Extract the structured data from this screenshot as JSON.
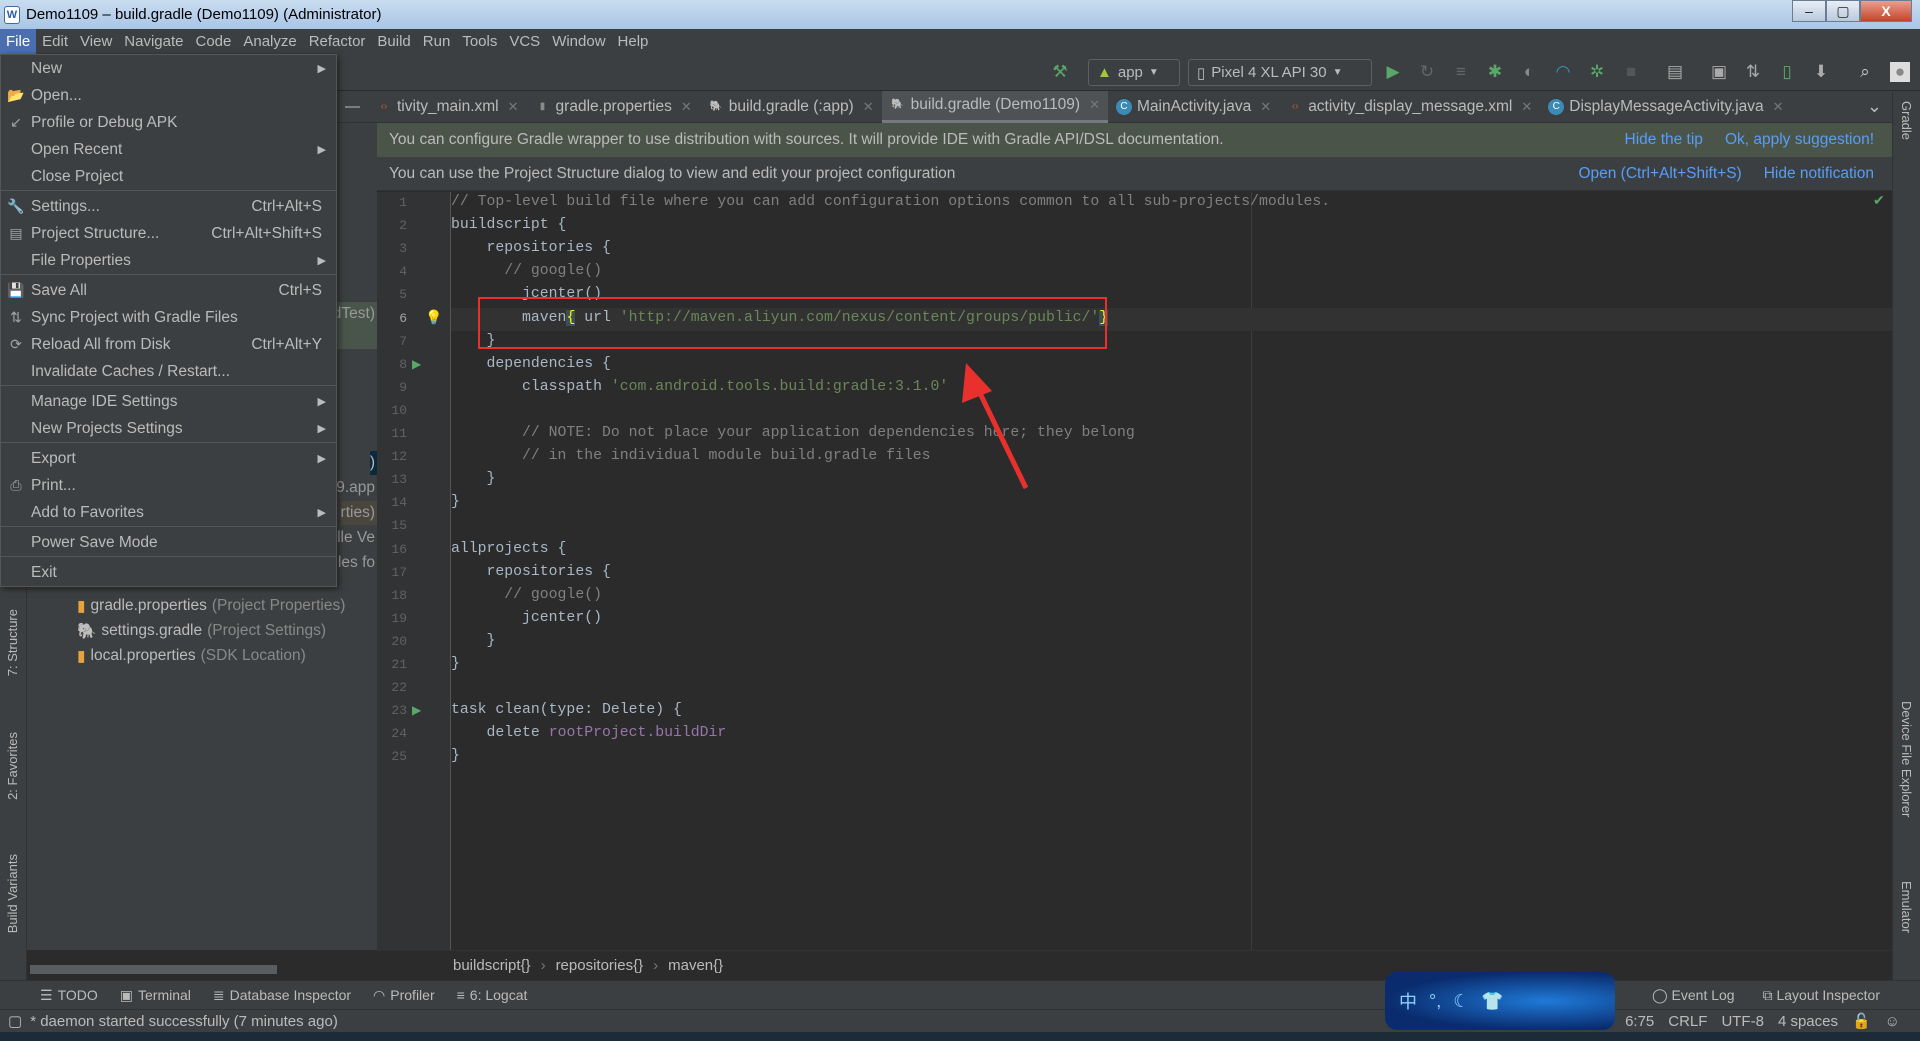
{
  "window": {
    "title": "Demo1109 – build.gradle (Demo1109) (Administrator)",
    "minimize": "–",
    "maximize": "▢",
    "close": "X"
  },
  "menubar": [
    "File",
    "Edit",
    "View",
    "Navigate",
    "Code",
    "Analyze",
    "Refactor",
    "Build",
    "Run",
    "Tools",
    "VCS",
    "Window",
    "Help"
  ],
  "toolbar": {
    "run_config": "app",
    "device": "Pixel 4 XL API 30",
    "icons": [
      "hammer-icon",
      "run-icon",
      "apply-changes-icon",
      "apply-code-changes-icon",
      "debug-icon",
      "attach-debugger-icon",
      "profile-icon",
      "debug-app-icon",
      "stop-icon",
      "project-structure-icon",
      "avd-manager-icon",
      "sync-gradle-icon",
      "device-manager-icon",
      "sdk-manager-icon",
      "search-icon",
      "account-icon"
    ]
  },
  "tabs": [
    {
      "label": "tivity_main.xml",
      "icon": "xml-icon"
    },
    {
      "label": "gradle.properties",
      "icon": "properties-icon"
    },
    {
      "label": "build.gradle (:app)",
      "icon": "gradle-icon"
    },
    {
      "label": "build.gradle (Demo1109)",
      "icon": "gradle-icon",
      "active": true
    },
    {
      "label": "MainActivity.java",
      "icon": "class-icon"
    },
    {
      "label": "activity_display_message.xml",
      "icon": "xml-icon"
    },
    {
      "label": "DisplayMessageActivity.java",
      "icon": "class-icon"
    }
  ],
  "notifications": [
    {
      "text": "You can configure Gradle wrapper to use distribution with sources. It will provide IDE with Gradle API/DSL documentation.",
      "links": [
        "Hide the tip",
        "Ok, apply suggestion!"
      ]
    },
    {
      "text": "You can use the Project Structure dialog to view and edit your project configuration",
      "links": [
        "Open (Ctrl+Alt+Shift+S)",
        "Hide notification"
      ]
    }
  ],
  "file_menu": [
    {
      "label": "New",
      "submenu": true
    },
    {
      "label": "Open...",
      "icon": "folder-icon"
    },
    {
      "label": "Profile or Debug APK",
      "icon": "profile-apk-icon"
    },
    {
      "label": "Open Recent",
      "submenu": true
    },
    {
      "label": "Close Project",
      "sep_after": true
    },
    {
      "label": "Settings...",
      "shortcut": "Ctrl+Alt+S",
      "icon": "wrench-icon"
    },
    {
      "label": "Project Structure...",
      "shortcut": "Ctrl+Alt+Shift+S",
      "icon": "project-structure-icon"
    },
    {
      "label": "File Properties",
      "submenu": true,
      "sep_after": true
    },
    {
      "label": "Save All",
      "shortcut": "Ctrl+S",
      "icon": "save-icon"
    },
    {
      "label": "Sync Project with Gradle Files",
      "icon": "gradle-sync-icon"
    },
    {
      "label": "Reload All from Disk",
      "shortcut": "Ctrl+Alt+Y",
      "icon": "reload-icon"
    },
    {
      "label": "Invalidate Caches / Restart...",
      "sep_after": true
    },
    {
      "label": "Manage IDE Settings",
      "submenu": true
    },
    {
      "label": "New Projects Settings",
      "submenu": true,
      "sep_after": true
    },
    {
      "label": "Export",
      "submenu": true
    },
    {
      "label": "Print...",
      "icon": "print-icon"
    },
    {
      "label": "Add to Favorites",
      "submenu": true,
      "sep_after": true
    },
    {
      "label": "Power Save Mode",
      "sep_after": true
    },
    {
      "label": "Exit"
    }
  ],
  "project_tree": {
    "fragments": [
      "dTest)",
      ")",
      "9.app",
      "rties)",
      "lle Ve",
      "ules fo"
    ],
    "items": [
      {
        "name": "gradle.properties",
        "hint": "(Project Properties)"
      },
      {
        "name": "settings.gradle",
        "hint": "(Project Settings)"
      },
      {
        "name": "local.properties",
        "hint": "(SDK Location)"
      }
    ]
  },
  "left_tools": [
    "7: Structure",
    "2: Favorites",
    "Build Variants"
  ],
  "right_tools": [
    "Gradle",
    "Device File Explorer",
    "Emulator"
  ],
  "editor": {
    "current_line": 6,
    "lines": [
      [
        [
          "c-com",
          "// Top-level build file where you can add configuration options common to all sub-projects/modules."
        ]
      ],
      [
        [
          "",
          "buildscript {"
        ]
      ],
      [
        [
          "",
          "    repositories {"
        ]
      ],
      [
        [
          "c-com",
          "      // google()"
        ]
      ],
      [
        [
          "",
          "        jcenter()"
        ]
      ],
      [
        [
          "",
          "        maven"
        ],
        [
          "c-brace",
          "{"
        ],
        [
          "",
          " url "
        ],
        [
          "c-str",
          "'http://maven.aliyun.com/nexus/content/groups/public/'"
        ],
        [
          "c-brace",
          "}"
        ]
      ],
      [
        [
          "",
          "    }"
        ]
      ],
      [
        [
          "",
          "    dependencies {"
        ]
      ],
      [
        [
          "",
          "        classpath "
        ],
        [
          "c-str",
          "'com.android.tools.build:gradle:3.1.0'"
        ]
      ],
      [
        [
          "",
          ""
        ]
      ],
      [
        [
          "c-com",
          "        // NOTE: Do not place your application dependencies here; they belong"
        ]
      ],
      [
        [
          "c-com",
          "        // in the individual module build.gradle files"
        ]
      ],
      [
        [
          "",
          "    }"
        ]
      ],
      [
        [
          "",
          "}"
        ]
      ],
      [
        [
          "",
          ""
        ]
      ],
      [
        [
          "",
          "allprojects {"
        ]
      ],
      [
        [
          "",
          "    repositories {"
        ]
      ],
      [
        [
          "c-com",
          "      // google()"
        ]
      ],
      [
        [
          "",
          "        jcenter()"
        ]
      ],
      [
        [
          "",
          "    }"
        ]
      ],
      [
        [
          "",
          "}"
        ]
      ],
      [
        [
          "",
          ""
        ]
      ],
      [
        [
          "",
          "task clean(type: Delete) {"
        ]
      ],
      [
        [
          "",
          "    delete "
        ],
        [
          "c-prop",
          "rootProject.buildDir"
        ]
      ],
      [
        [
          "",
          "}"
        ]
      ]
    ],
    "run_markers": [
      8,
      23
    ]
  },
  "breadcrumb": [
    "buildscript{}",
    "repositories{}",
    "maven{}"
  ],
  "bottom_tools": [
    {
      "label": "TODO",
      "icon": "list-icon"
    },
    {
      "label": "Terminal",
      "icon": "terminal-icon"
    },
    {
      "label": "Database Inspector",
      "icon": "database-icon"
    },
    {
      "label": "Profiler",
      "icon": "profiler-icon"
    },
    {
      "label": "6: Logcat",
      "icon": "logcat-icon"
    }
  ],
  "bottom_right_tools": [
    "Event Log",
    "Layout Inspector"
  ],
  "status": {
    "message": "* daemon started successfully (7 minutes ago)",
    "position": "6:75",
    "line_sep": "CRLF",
    "encoding": "UTF-8",
    "indent": "4 spaces"
  },
  "ime": {
    "label": "中"
  },
  "annotation_color": "#e8312d"
}
